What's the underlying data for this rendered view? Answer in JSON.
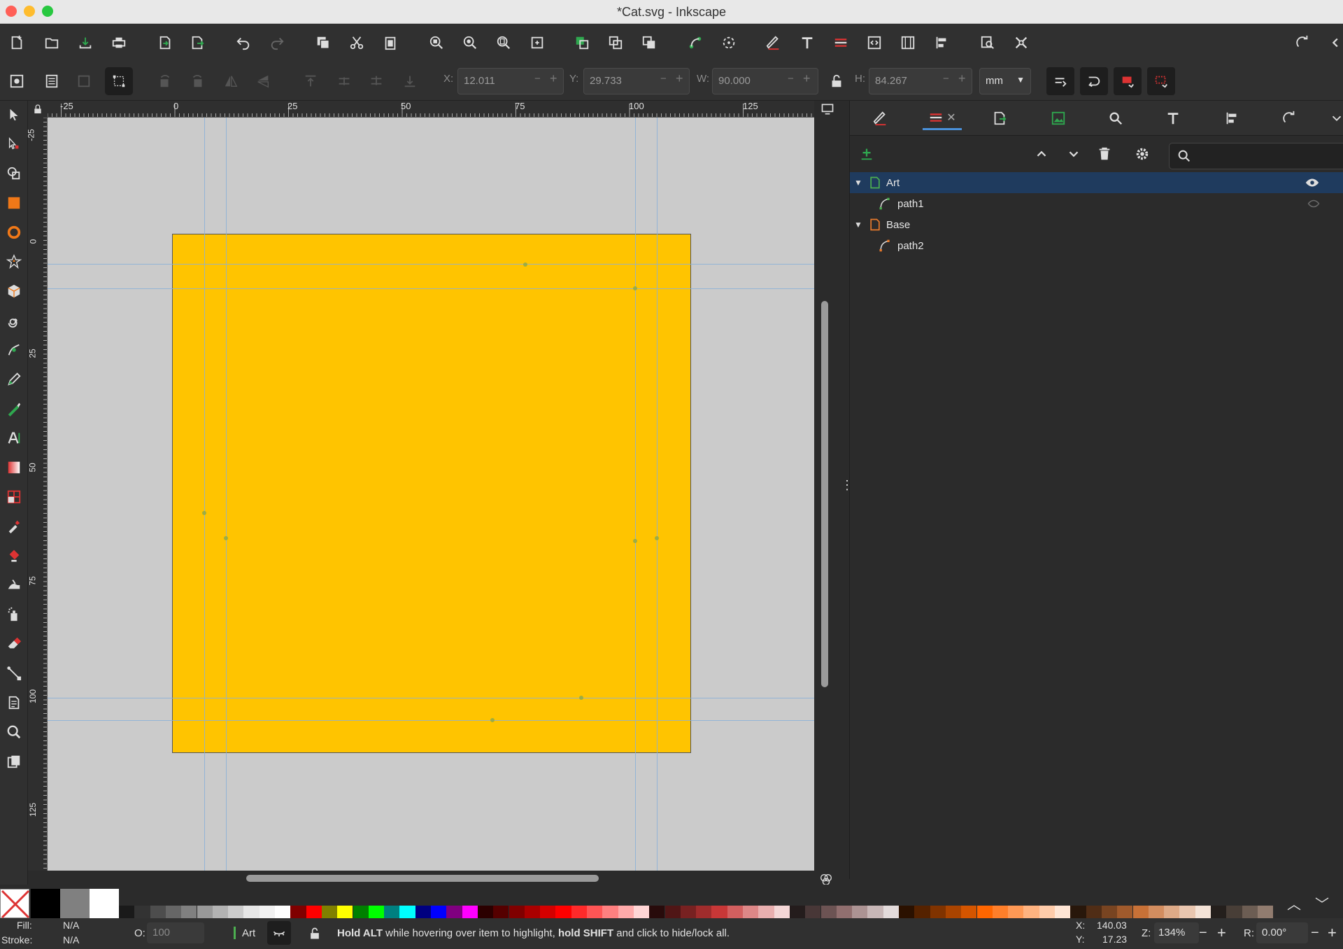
{
  "window": {
    "title": "*Cat.svg - Inkscape",
    "traffic_colors": [
      "#ff5f57",
      "#febc2e",
      "#28c840"
    ]
  },
  "command_bar": {
    "icons": [
      "new-document-icon",
      "open-icon",
      "save-icon",
      "print-icon",
      "import-icon",
      "export-icon",
      "undo-icon",
      "redo-icon",
      "duplicate-icon",
      "cut-icon",
      "paste-icon",
      "zoom-selection-icon",
      "zoom-drawing-icon",
      "zoom-page-icon",
      "zoom-center-icon",
      "group-icon",
      "ungroup-icon",
      "clone-icon",
      "node-editor-icon",
      "transform-icon",
      "fill-stroke-icon",
      "text-icon",
      "layers-icon",
      "xml-editor-icon",
      "document-properties-icon",
      "align-icon",
      "preferences-icon",
      "export-dialog-icon",
      "tools-icon"
    ]
  },
  "select_controls": {
    "x_label": "X:",
    "x_value": "12.011",
    "y_label": "Y:",
    "y_value": "29.733",
    "w_label": "W:",
    "w_value": "90.000",
    "h_label": "H:",
    "h_value": "84.267",
    "unit": "mm",
    "stepper_minus": "−",
    "stepper_plus": "+"
  },
  "rulers": {
    "top_labels": [
      "-25",
      "0",
      "25",
      "50",
      "75",
      "100",
      "125"
    ],
    "left_labels": [
      "-25",
      "0",
      "25",
      "50",
      "75",
      "100",
      "125"
    ]
  },
  "tools": [
    "selector-icon",
    "node-icon",
    "shape-builder-icon",
    "rectangle-icon",
    "ellipse-icon",
    "star-icon",
    "3d-box-icon",
    "spiral-icon",
    "pen-icon",
    "pencil-icon",
    "calligraphy-icon",
    "text-tool-icon",
    "gradient-icon",
    "mesh-icon",
    "dropper-icon",
    "paint-bucket-icon",
    "tweak-icon",
    "spray-icon",
    "eraser-icon",
    "connector-icon",
    "pages-icon",
    "zoom-icon",
    "measure-icon"
  ],
  "panel": {
    "tabs": [
      "fill-stroke-tab",
      "layers-tab",
      "export-tab",
      "image-tab",
      "find-tab",
      "text-tab",
      "align-tab",
      "history-tab"
    ],
    "layers": [
      {
        "name": "Art",
        "kind": "layer",
        "color": "#4caf50",
        "selected": true
      },
      {
        "name": "path1",
        "kind": "path",
        "color": "#4caf50",
        "selected": false
      },
      {
        "name": "Base",
        "kind": "layer",
        "color": "#e87a2c",
        "selected": false
      },
      {
        "name": "path2",
        "kind": "path",
        "color": "#e87a2c",
        "selected": false
      }
    ]
  },
  "canvas": {
    "page_color": "#ffc400",
    "background": "#cbcbcb"
  },
  "palette": {
    "swatches": [
      "#000000",
      "#808080",
      "#ffffff",
      "#1a1a1a",
      "#333333",
      "#4d4d4d",
      "#666666",
      "#808080",
      "#999999",
      "#b3b3b3",
      "#cccccc",
      "#e6e6e6",
      "#f2f2f2",
      "#ffffff",
      "#800000",
      "#ff0000",
      "#808000",
      "#ffff00",
      "#008000",
      "#00ff00",
      "#008080",
      "#00ffff",
      "#000080",
      "#0000ff",
      "#800080",
      "#ff00ff",
      "#2b0000",
      "#550000",
      "#800000",
      "#aa0000",
      "#d40000",
      "#ff0000",
      "#ff2a2a",
      "#ff5555",
      "#ff8080",
      "#ffaaaa",
      "#ffd5d5",
      "#280b0b",
      "#501616",
      "#782121",
      "#a02c2c",
      "#c83737",
      "#d35f5f",
      "#de8787",
      "#e9afaf",
      "#f4d7d7",
      "#241c1c",
      "#483737",
      "#6c5353",
      "#916f6f",
      "#ac9393",
      "#c8b7b7",
      "#e3dbdb",
      "#2b1100",
      "#552200",
      "#803300",
      "#aa4400",
      "#d45500",
      "#ff6600",
      "#ff7f2a",
      "#ff9955",
      "#ffb380",
      "#ffccaa",
      "#ffe6d5",
      "#28170b",
      "#502d16",
      "#784421",
      "#a05a2c",
      "#c87137",
      "#d38d5f",
      "#deaa87",
      "#e9c6af",
      "#f4e3d7",
      "#241f1c",
      "#483e37",
      "#6c5d53",
      "#917c6f"
    ]
  },
  "status": {
    "fill_label": "Fill:",
    "fill_value": "N/A",
    "stroke_label": "Stroke:",
    "stroke_value": "N/A",
    "opacity_label": "O:",
    "opacity_value": "100",
    "layer_name": "Art",
    "message_bold1": "Hold ALT",
    "message_mid": " while hovering over item to highlight, ",
    "message_bold2": "hold SHIFT",
    "message_end": " and click to hide/lock all.",
    "cursor_x_label": "X:",
    "cursor_x": "140.03",
    "cursor_y_label": "Y:",
    "cursor_y": "17.23",
    "zoom_label": "Z:",
    "zoom": "134%",
    "rotate_label": "R:",
    "rotate": "0.00°"
  }
}
